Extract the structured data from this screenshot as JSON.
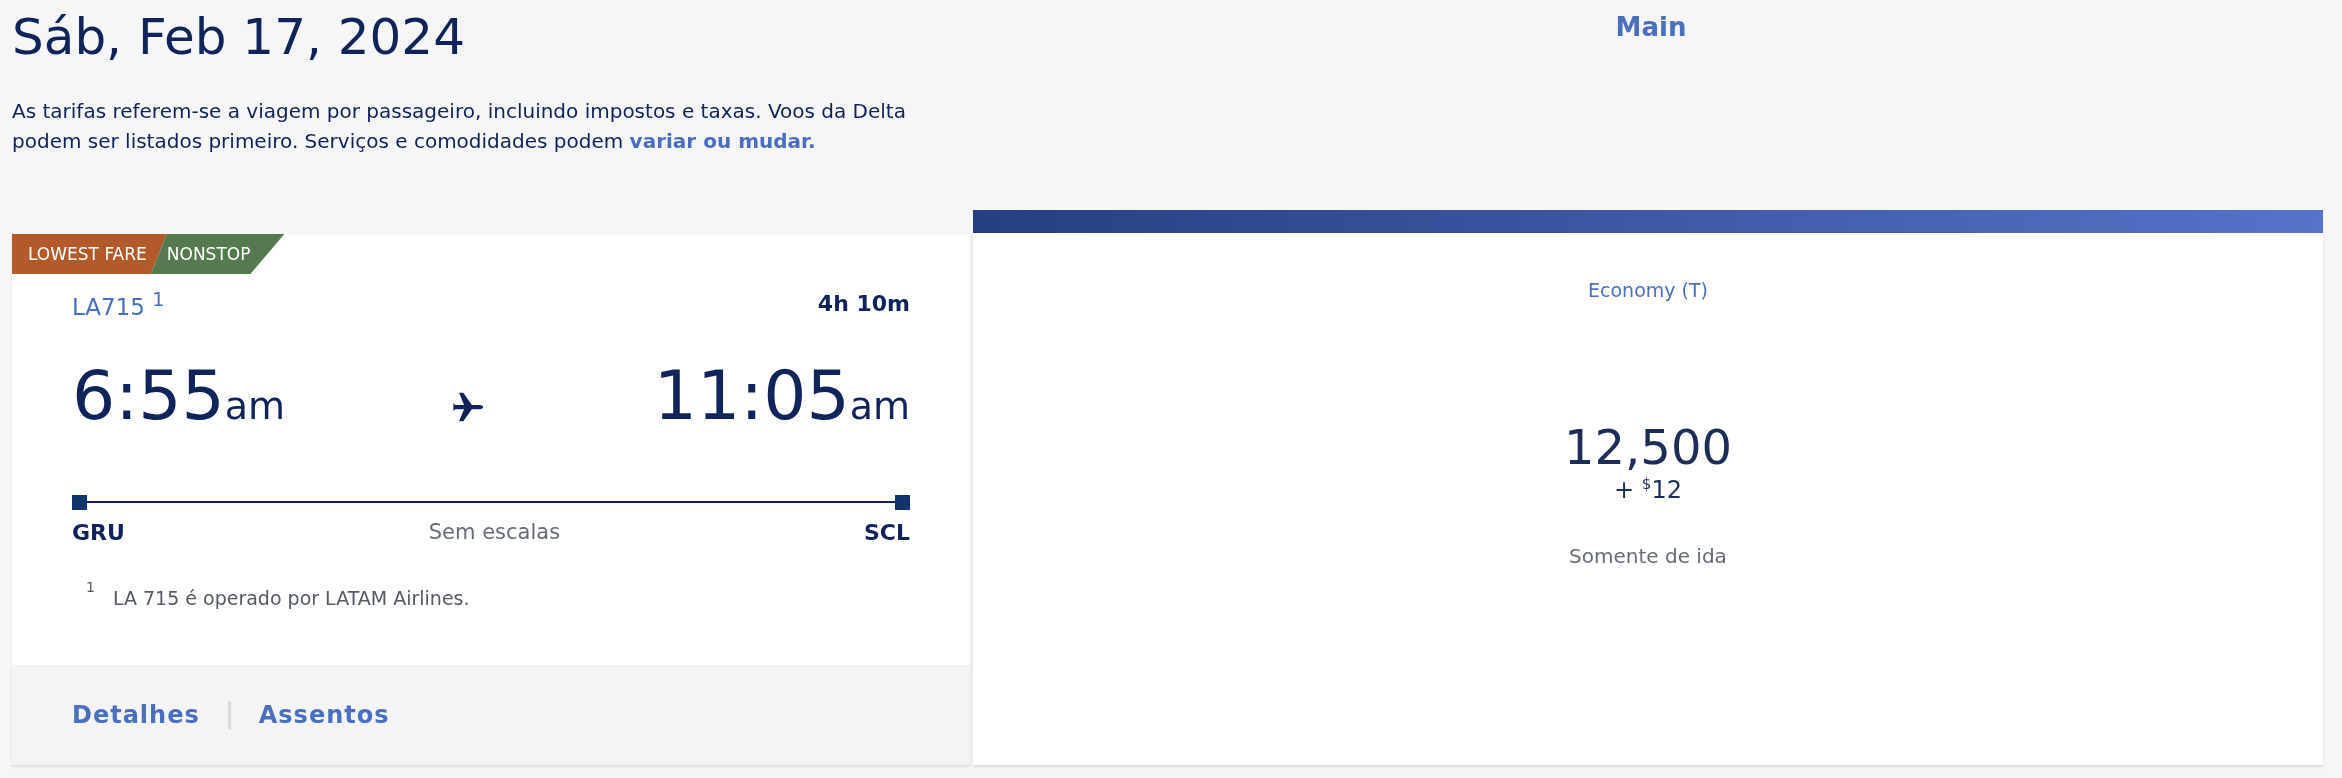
{
  "date_title": "Sáb, Feb 17, 2024",
  "notice": {
    "text": "As tarifas referem-se a viagem por passageiro, incluindo impostos e taxas. Voos da Delta podem ser listados primeiro. Serviços e comodidades podem ",
    "link": "variar ou mudar."
  },
  "fare_column": {
    "title": "Main"
  },
  "flight_card": {
    "tags": [
      {
        "label": "LOWEST FARE",
        "color": "#b35a2a"
      },
      {
        "label": "NONSTOP",
        "color": "#567a4f"
      }
    ],
    "flight_number": "LA715 $^{1}$",
    "duration": "4h 10m",
    "departure": {
      "time": "6:55",
      "period": "am",
      "airport": "GRU"
    },
    "arrival": {
      "time": "11:05",
      "period": "am",
      "airport": "SCL"
    },
    "stops": "Sem escalas",
    "footnote": {
      "mark": "1",
      "text": "LA 715 é operado por LATAM Airlines."
    },
    "links": [
      "Detalhes",
      "Assentos"
    ]
  },
  "fare_card": {
    "cabin": "Economy (T)",
    "miles": "12,500",
    "taxes": "+ $^{$}$12",
    "trip_type": "Somente de ida"
  }
}
